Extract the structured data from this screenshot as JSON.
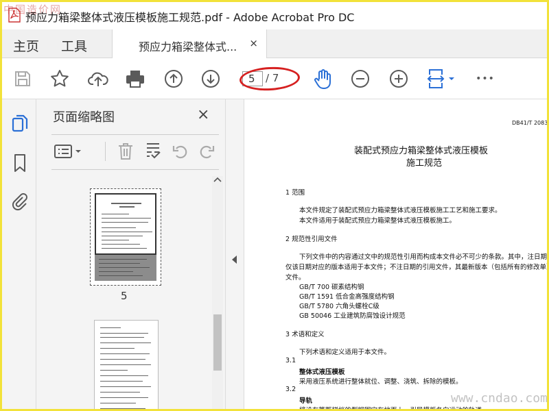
{
  "window": {
    "title": "预应力箱梁整体式液压模板施工规范.pdf - Adobe Acrobat Pro DC",
    "watermark_top": "中国造价网"
  },
  "tabs": {
    "home": "主页",
    "tools": "工具",
    "document": "预应力箱梁整体式...",
    "close": "×"
  },
  "toolbar": {
    "current_page": "5",
    "total_pages": "/ 7",
    "more": "•••"
  },
  "thumbnail_panel": {
    "title": "页面缩略图",
    "close": "×",
    "thumbnail_page_label": "5"
  },
  "document": {
    "standard_no": "DB41/T 2083-",
    "title_line1": "装配式预应力箱梁整体式液压模板",
    "title_line2": "施工规范",
    "lines": [
      "1  范围",
      "本文件规定了装配式预应力箱梁整体式液压模板施工工艺和施工要求。",
      "本文件适用于装配式预应力箱梁整体式液压模板施工。",
      "2  规范性引用文件",
      "下列文件中的内容通过文中的规范性引用而构成本文件必不可少的条款。其中，注日期的引用",
      "仅该日期对应的版本适用于本文件；不注日期的引用文件，其最新版本（包括所有的修改单）适用",
      "文件。",
      "GB/T 700   碳素结构钢",
      "GB/T 1591   低合金高强度结构钢",
      "GB/T 5780   六角头螺栓C级",
      "GB 50046   工业建筑防腐蚀设计规范",
      "3  术语和定义",
      "下列术语和定义适用于本文件。",
      "3.1",
      "整体式液压模板",
      "采用液压系统进行整体就位、调整、浇筑、拆除的模板。",
      "3.2",
      "导轨",
      "将设有等距梯档的型钢固定在地面上，引导模板各向运动的轨道。"
    ]
  },
  "watermark_bottom": "www.cndao.com",
  "colors": {
    "acrobat_red": "#d62020",
    "icon_gray": "#5a5a5a",
    "hand_blue": "#2a6fd6",
    "highlight_border": "#f2e23a"
  }
}
